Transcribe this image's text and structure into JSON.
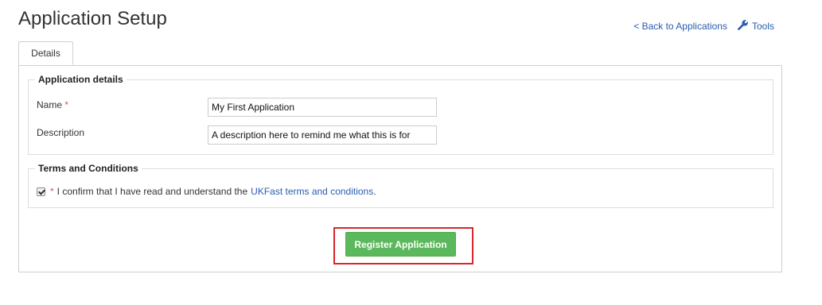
{
  "page": {
    "title": "Application Setup"
  },
  "links": {
    "back": "< Back to Applications",
    "tools": "Tools",
    "tools_icon": "wrench-icon",
    "color": "#2a5db0"
  },
  "tabs": [
    {
      "label": "Details",
      "active": true
    }
  ],
  "application_details": {
    "legend": "Application details",
    "name_label": "Name",
    "required_mark": "*",
    "name_value": "My First Application",
    "description_label": "Description",
    "description_value": "A description here to remind me what this is for"
  },
  "terms": {
    "legend": "Terms and Conditions",
    "checked": true,
    "required_mark": "*",
    "text": "I confirm that I have read and understand the",
    "link_text": "UKFast terms and conditions",
    "period": "."
  },
  "actions": {
    "register_label": "Register Application",
    "register_color": "#5cb85c",
    "highlight_color": "#d9262b"
  }
}
